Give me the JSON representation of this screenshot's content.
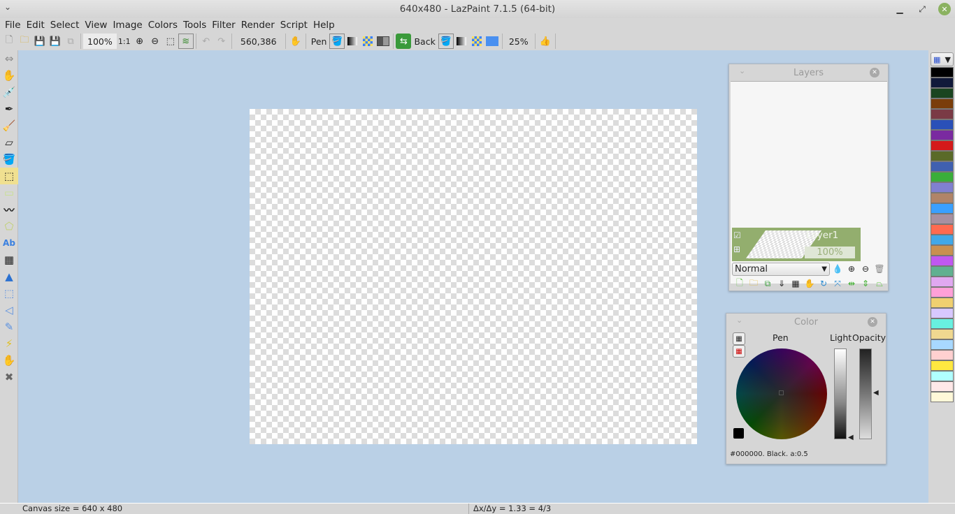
{
  "window": {
    "title": "640x480 - LazPaint 7.1.5 (64-bit)",
    "controls": {
      "minimize": "minimize-icon",
      "maximize": "maximize-icon",
      "close": "close-icon"
    }
  },
  "menu": [
    "File",
    "Edit",
    "Select",
    "View",
    "Image",
    "Colors",
    "Tools",
    "Filter",
    "Render",
    "Script",
    "Help"
  ],
  "toolbar": {
    "zoom_value": "100%",
    "zoom_original": "1:1",
    "coordinates": "560,386",
    "pen_label": "Pen",
    "back_label": "Back",
    "tolerance": "25%",
    "icons": [
      "new-file-icon",
      "open-folder-icon",
      "save-icon",
      "save-as-icon",
      "copy-icon",
      "zoom-in-icon",
      "zoom-out-icon",
      "zoom-fit-icon",
      "layers-icon",
      "undo-icon",
      "redo-icon",
      "hand-icon",
      "pen-fill-icon",
      "gradient-icon",
      "texture-icon",
      "pen-color-icon",
      "swap-colors-icon",
      "back-fill-icon",
      "back-gradient-icon",
      "back-texture-icon",
      "back-color-icon",
      "thumbs-up-icon"
    ]
  },
  "tools": [
    "move-view-icon",
    "hand-icon",
    "color-picker-icon",
    "pen-icon",
    "brush-icon",
    "eraser-icon",
    "flood-fill-icon",
    "edit-shape-icon",
    "rectangle-icon",
    "polyline-icon",
    "polygon-icon",
    "text-icon",
    "phong-icon",
    "gradient-fill-icon",
    "select-rect-icon",
    "select-poly-icon",
    "select-pen-icon",
    "magic-wand-icon",
    "move-selection-icon",
    "deselect-icon"
  ],
  "tool_glyphs": [
    "⇔",
    "✋",
    "💉",
    "✒",
    "🧹",
    "▱",
    "🪣",
    "⬚",
    "▭",
    "〰",
    "⬠",
    "Ab",
    "▦",
    "▲",
    "⬚",
    "◁",
    "✎",
    "⚡",
    "✋",
    "✖"
  ],
  "layers_panel": {
    "title": "Layers",
    "layer": {
      "name": "Layer1",
      "opacity": "100%",
      "visible": true
    },
    "blend_mode": "Normal",
    "tools": [
      "add-layer-icon",
      "import-layer-icon",
      "duplicate-layer-icon",
      "merge-down-icon",
      "rasterize-icon",
      "move-layer-icon",
      "rotate-layer-icon",
      "zoom-layer-icon",
      "flip-h-icon",
      "flip-v-icon",
      "perspective-icon"
    ]
  },
  "color_panel": {
    "title": "Color",
    "target_label": "Pen",
    "lightness_label": "Light",
    "opacity_label": "Opacity",
    "color_description": "#000000. Black. a:0.5",
    "current_color": "#000000",
    "alpha": 0.5
  },
  "palette": [
    "#000000",
    "#111a3a",
    "#1a4520",
    "#7a3d0a",
    "#7a3a45",
    "#2a50b8",
    "#7a2aa0",
    "#d41a1a",
    "#5a6a28",
    "#4060b0",
    "#3aae3a",
    "#8080d0",
    "#b08468",
    "#3aa0ff",
    "#a890a0",
    "#ff6a50",
    "#40a8e8",
    "#c89050",
    "#c058f0",
    "#60b090",
    "#e0a8f0",
    "#ffa0d8",
    "#f0d070",
    "#d8c8ff",
    "#68f0e0",
    "#f0d890",
    "#a8d8ff",
    "#ffd0d0",
    "#ffe840",
    "#b0ffff",
    "#ffe8e8",
    "#fff8d8"
  ],
  "status": {
    "canvas_size": "Canvas size = 640 x 480",
    "ratio": "Δx/Δy = 1.33 = 4/3"
  }
}
